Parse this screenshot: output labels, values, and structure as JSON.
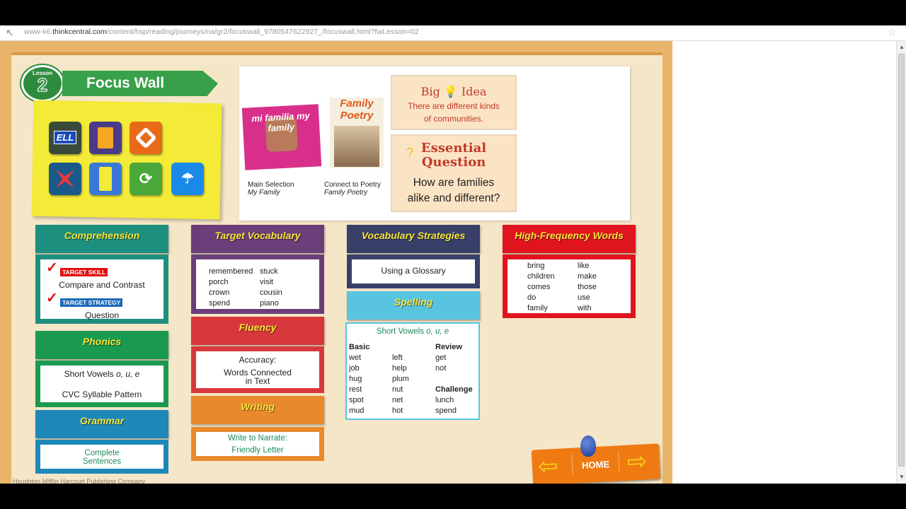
{
  "browser": {
    "url_prefix": "www-k6.",
    "url_domain": "thinkcentral.com",
    "url_path": "/content/hsp/reading/journeys/na/gr2/focuswall_9780547622927_/focuswall.html?fwLesson=02"
  },
  "lesson": {
    "label": "Lesson",
    "number": "2",
    "title": "Focus Wall"
  },
  "icons": [
    {
      "name": "ell-icon",
      "text": "ELL",
      "color": "#3a4a3a"
    },
    {
      "name": "book-icon",
      "text": "",
      "color": "#4a3a8a"
    },
    {
      "name": "diamond-icon",
      "text": "",
      "color": "#e86a18"
    },
    {
      "name": "puzzle-icon",
      "text": "",
      "color": "#1a5a8a"
    },
    {
      "name": "flashcards-icon",
      "text": "",
      "color": "#3a78d8"
    },
    {
      "name": "cycle-icon",
      "text": "",
      "color": "#4aa83a"
    },
    {
      "name": "parachute-icon",
      "text": "",
      "color": "#1a8ae8"
    }
  ],
  "books": {
    "main_cover_title": "mi familia my family",
    "poetry_cover_title": "Family Poetry",
    "main_caption": "Main Selection",
    "main_title": "My Family",
    "poetry_caption": "Connect to Poetry",
    "poetry_title": "Family Poetry"
  },
  "big_idea": {
    "heading_a": "Big",
    "heading_b": "Idea",
    "body_a": "There are different kinds",
    "body_b": "of communities."
  },
  "essential": {
    "heading_a": "Essential",
    "heading_b": "Question",
    "body_a": "How are families",
    "body_b": "alike and different?"
  },
  "comprehension": {
    "title": "Comprehension",
    "skill_tag": "TARGET SKILL",
    "skill": "Compare and Contrast",
    "strategy_tag": "TARGET STRATEGY",
    "strategy": "Question"
  },
  "phonics": {
    "title": "Phonics",
    "line1_pre": "Short Vowels ",
    "line1_letters": "o, u, e",
    "line2": "CVC Syllable Pattern"
  },
  "grammar": {
    "title": "Grammar",
    "line1": "Complete",
    "line2": "Sentences"
  },
  "vocab": {
    "title": "Target Vocabulary",
    "col1": [
      "remembered",
      "porch",
      "crown",
      "spend"
    ],
    "col2": [
      "stuck",
      "visit",
      "cousin",
      "piano"
    ]
  },
  "fluency": {
    "title": "Fluency",
    "line1": "Accuracy:",
    "line2": "Words Connected",
    "line3": "in Text"
  },
  "writing": {
    "title": "Writing",
    "line1": "Write to Narrate:",
    "line2": "Friendly Letter"
  },
  "vstrat": {
    "title": "Vocabulary Strategies",
    "body": "Using a Glossary"
  },
  "spelling": {
    "title": "Spelling",
    "subtitle_pre": "Short Vowels ",
    "subtitle_letters": "o, u, e",
    "basic_label": "Basic",
    "col1": [
      "wet",
      "job",
      "hug",
      "rest",
      "spot",
      "mud"
    ],
    "col2": [
      "left",
      "help",
      "plum",
      "nut",
      "net",
      "hot"
    ],
    "review_label": "Review",
    "review": [
      "get",
      "not"
    ],
    "challenge_label": "Challenge",
    "challenge": [
      "lunch",
      "spend"
    ]
  },
  "hfw": {
    "title": "High-Frequency Words",
    "col1": [
      "bring",
      "children",
      "comes",
      "do",
      "family"
    ],
    "col2": [
      "like",
      "make",
      "those",
      "use",
      "with"
    ]
  },
  "nav": {
    "home": "HOME",
    "prev": "⇦",
    "next": "⇨"
  },
  "footer": {
    "copyright": "Houghton Mifflin Harcourt Publishing Company"
  }
}
